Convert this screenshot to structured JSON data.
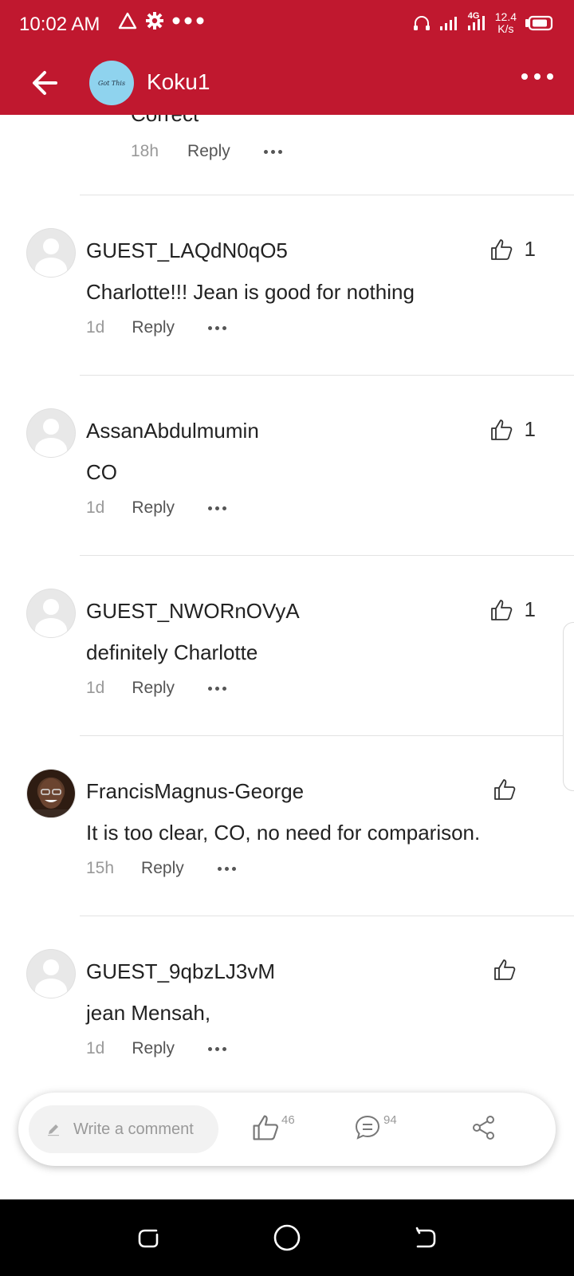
{
  "status_bar": {
    "time": "10:02 AM",
    "network_type": "4G",
    "speed_value": "12.4",
    "speed_unit": "K/s"
  },
  "header": {
    "channel_logo_text": "Got This",
    "channel_name": "Koku1"
  },
  "previous_comment": {
    "text_partial": "Correct",
    "time": "18h",
    "reply_label": "Reply"
  },
  "comments": [
    {
      "name": "GUEST_LAQdN0qO5",
      "text": "Charlotte!!! Jean is good for nothing",
      "time": "1d",
      "reply_label": "Reply",
      "likes": "1"
    },
    {
      "name": "AssanAbdulmumin",
      "text": "CO",
      "time": "1d",
      "reply_label": "Reply",
      "likes": "1"
    },
    {
      "name": "GUEST_NWORnOVyA",
      "text": "definitely Charlotte",
      "time": "1d",
      "reply_label": "Reply",
      "likes": "1"
    },
    {
      "name": "FrancisMagnus-George",
      "text": "It is too clear, CO, no need for comparison.",
      "time": "15h",
      "reply_label": "Reply",
      "likes": ""
    },
    {
      "name": "GUEST_9qbzLJ3vM",
      "text": "jean Mensah,",
      "time": "1d",
      "reply_label": "Reply",
      "likes": ""
    }
  ],
  "bottom_bar": {
    "placeholder": "Write a comment",
    "like_count": "46",
    "comment_count": "94"
  },
  "colors": {
    "brand": "#c0182f"
  }
}
